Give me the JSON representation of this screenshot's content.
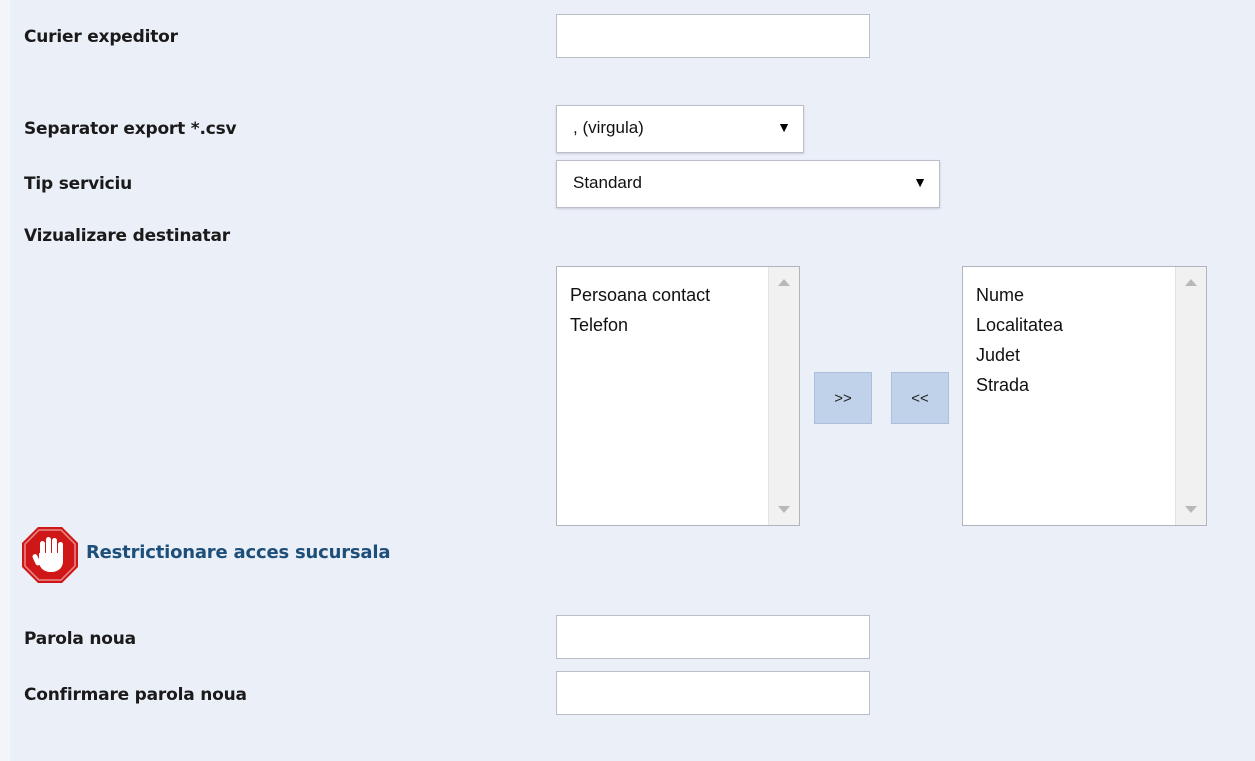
{
  "form": {
    "courier_label": "Curier expeditor",
    "courier_value": "",
    "separator_label": "Separator export *.csv",
    "separator_selected": ", (virgula)",
    "service_label": "Tip serviciu",
    "service_selected": "Standard",
    "recipient_view_label": "Vizualizare destinatar",
    "available_fields": [
      "Persoana contact",
      "Telefon"
    ],
    "selected_fields": [
      "Nume",
      "Localitatea",
      "Judet",
      "Strada"
    ],
    "add_button_label": ">>",
    "remove_button_label": "<<"
  },
  "restriction": {
    "title": "Restrictionare acces sucursala",
    "icon": "stop-hand-icon",
    "icon_color": "#d01717"
  },
  "password": {
    "new_label": "Parola noua",
    "new_value": "",
    "confirm_label": "Confirmare parola noua",
    "confirm_value": ""
  },
  "colors": {
    "panel_bg": "#ebeff8",
    "button_bg": "#bfd2ea",
    "section_title": "#1d4f7a"
  }
}
